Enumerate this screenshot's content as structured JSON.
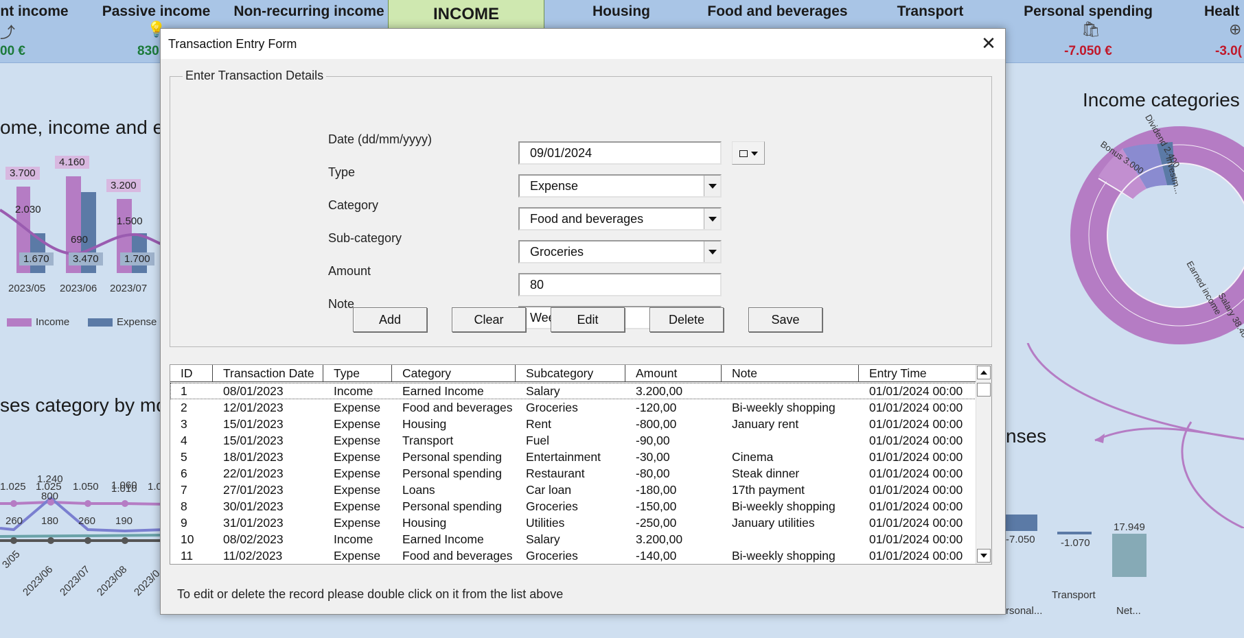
{
  "topbar": {
    "items": [
      {
        "label": "nt income",
        "value": "00 €",
        "color": "green"
      },
      {
        "label": "Passive income",
        "value": "830",
        "color": "green"
      },
      {
        "label": "Non-recurring income",
        "value": "",
        "color": "green"
      },
      {
        "label": "INCOME",
        "value": "",
        "color": "green"
      },
      {
        "label": "Housing",
        "value": "",
        "color": "red"
      },
      {
        "label": "Food and beverages",
        "value": "",
        "color": "red"
      },
      {
        "label": "Transport",
        "value": "",
        "color": "red"
      },
      {
        "label": "Personal spending",
        "value": "-7.050 €",
        "color": "red"
      },
      {
        "label": "Healt",
        "value": "-3.0(",
        "color": "red"
      }
    ]
  },
  "background": {
    "chart1_title": "ome, income and e",
    "chart1_months": [
      "2023/05",
      "2023/06",
      "2023/07"
    ],
    "chart1_income_labels": [
      "3.700",
      "4.160",
      "3.200"
    ],
    "chart1_mid_labels": [
      "2.030",
      "690",
      "1.500"
    ],
    "chart1_expense_labels": [
      "1.670",
      "3.470",
      "1.700"
    ],
    "chart1_legend": [
      "Income",
      "Expense"
    ],
    "chart2_title": "ses category by mo",
    "chart2_labels": [
      "1.025",
      "1.025",
      "1.240",
      "1.050",
      "1.060",
      "1.010",
      "1.0",
      "800",
      "260",
      "180",
      "260",
      "190"
    ],
    "chart2_months": [
      "3/05",
      "2023/06",
      "2023/07",
      "2023/08",
      "2023/0"
    ],
    "donut_title": "Income categories",
    "donut_labels": [
      "Bonus 3.000",
      "Dividend 2.400",
      "investm...",
      "Earned income",
      "Salary 38.400"
    ],
    "waterfall_title": "nses",
    "waterfall_values": [
      "-7.050",
      "-1.070",
      "17.949"
    ],
    "waterfall_cats": [
      "Transport",
      "rsonal...",
      "Net..."
    ],
    "colors": {
      "purple": "#b57cc4",
      "blue": "#5b7aa6",
      "green": "#1b7a3a",
      "red": "#c0182a"
    }
  },
  "dialog": {
    "title": "Transaction Entry Form",
    "close_icon": "close-icon",
    "group_label": "Enter Transaction Details",
    "fields": {
      "date": {
        "label": "Date (dd/mm/yyyy)",
        "value": "09/01/2024"
      },
      "type": {
        "label": "Type",
        "value": "Expense"
      },
      "category": {
        "label": "Category",
        "value": "Food and beverages"
      },
      "subcategory": {
        "label": "Sub-category",
        "value": "Groceries"
      },
      "amount": {
        "label": "Amount",
        "value": "80"
      },
      "note": {
        "label": "Note",
        "value": "Weekly shopping"
      }
    },
    "buttons": {
      "add": "Add",
      "clear": "Clear",
      "edit": "Edit",
      "delete": "Delete",
      "save": "Save"
    },
    "table": {
      "columns": [
        "ID",
        "Transaction Date",
        "Type",
        "Category",
        "Subcategory",
        "Amount",
        "Note",
        "Entry Time"
      ],
      "rows": [
        [
          "1",
          "08/01/2023",
          "Income",
          "Earned Income",
          "Salary",
          "3.200,00",
          "",
          "01/01/2024 00:00"
        ],
        [
          "2",
          "12/01/2023",
          "Expense",
          "Food and beverages",
          "Groceries",
          "-120,00",
          "Bi-weekly shopping",
          "01/01/2024 00:00"
        ],
        [
          "3",
          "15/01/2023",
          "Expense",
          "Housing",
          "Rent",
          "-800,00",
          "January rent",
          "01/01/2024 00:00"
        ],
        [
          "4",
          "15/01/2023",
          "Expense",
          "Transport",
          "Fuel",
          "-90,00",
          "",
          "01/01/2024 00:00"
        ],
        [
          "5",
          "18/01/2023",
          "Expense",
          "Personal spending",
          "Entertainment",
          "-30,00",
          "Cinema",
          "01/01/2024 00:00"
        ],
        [
          "6",
          "22/01/2023",
          "Expense",
          "Personal spending",
          "Restaurant",
          "-80,00",
          "Steak dinner",
          "01/01/2024 00:00"
        ],
        [
          "7",
          "27/01/2023",
          "Expense",
          "Loans",
          "Car loan",
          "-180,00",
          "17th payment",
          "01/01/2024 00:00"
        ],
        [
          "8",
          "30/01/2023",
          "Expense",
          "Personal spending",
          "Groceries",
          "-150,00",
          "Bi-weekly shopping",
          "01/01/2024 00:00"
        ],
        [
          "9",
          "31/01/2023",
          "Expense",
          "Housing",
          "Utilities",
          "-250,00",
          "January utilities",
          "01/01/2024 00:00"
        ],
        [
          "10",
          "08/02/2023",
          "Income",
          "Earned Income",
          "Salary",
          "3.200,00",
          "",
          "01/01/2024 00:00"
        ],
        [
          "11",
          "11/02/2023",
          "Expense",
          "Food and beverages",
          "Groceries",
          "-140,00",
          "Bi-weekly shopping",
          "01/01/2024 00:00"
        ]
      ]
    },
    "hint": "To edit or delete the record please double click on it from the list above"
  }
}
